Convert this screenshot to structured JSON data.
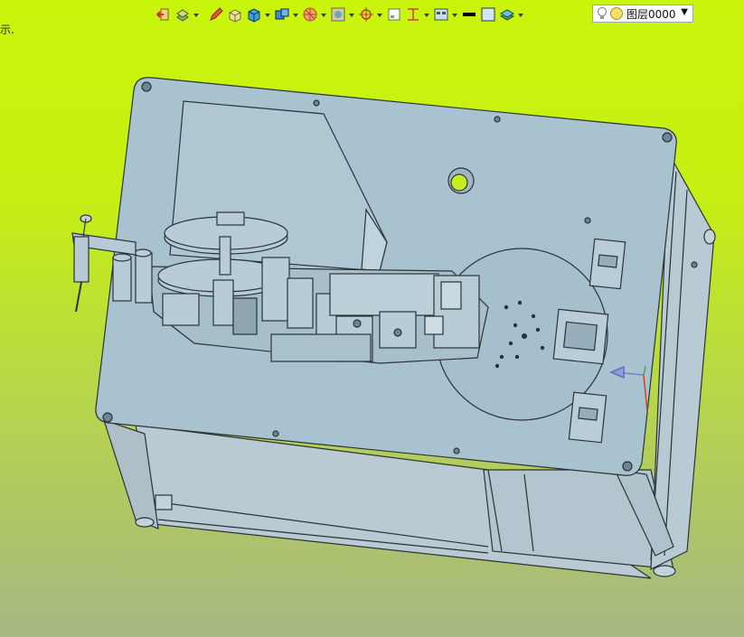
{
  "left_hint": "示.",
  "toolbar": {
    "icons": [
      "exit-icon",
      "layer-fill-icon",
      "pencil-icon",
      "box-edit-icon",
      "cube-icon",
      "extrude-icon",
      "render-icon",
      "view-icon",
      "snap-target-icon",
      "frame-icon",
      "dimension-icon",
      "display-mode-icon",
      "line-color-icon",
      "fill-color-icon",
      "layers-icon"
    ],
    "layer_name": "图层0000"
  },
  "colors": {
    "machine_fill": "#a9c2cf",
    "machine_stroke": "#2b3338",
    "frame_fill": "#b3c6d0",
    "highlight_yellow": "#c9ec1b"
  }
}
